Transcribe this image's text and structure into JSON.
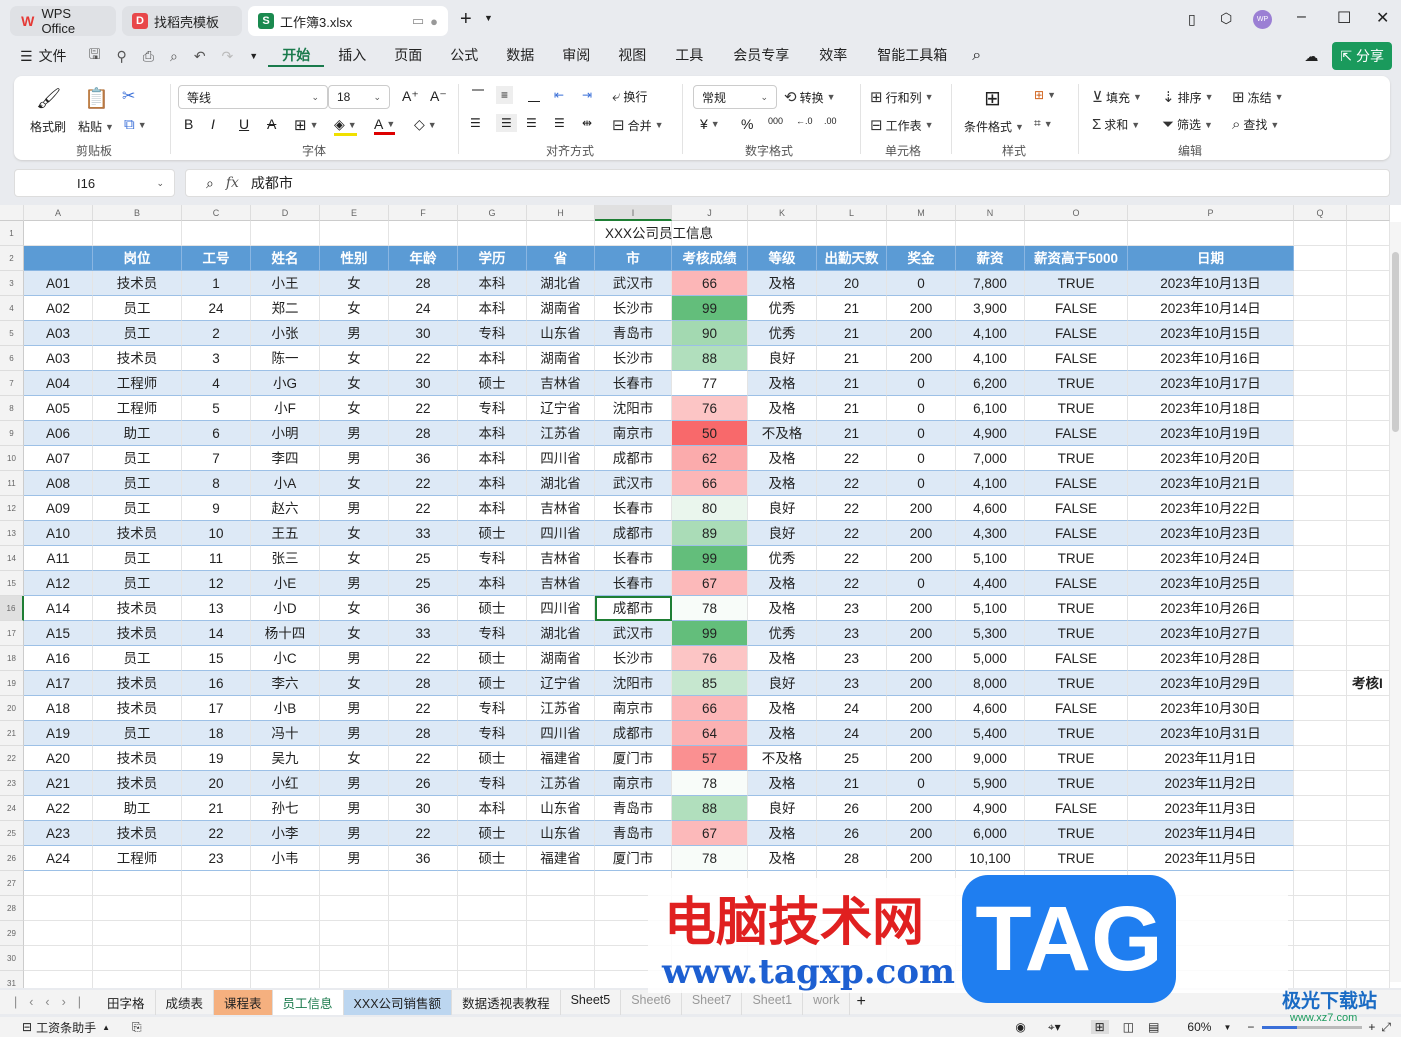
{
  "tabs": [
    {
      "label": "WPS Office",
      "icon": "W"
    },
    {
      "label": "找稻壳模板",
      "icon": "D"
    },
    {
      "label": "工作簿3.xlsx",
      "icon": "S"
    }
  ],
  "menu": {
    "file": "文件",
    "items": [
      "开始",
      "插入",
      "页面",
      "公式",
      "数据",
      "审阅",
      "视图",
      "工具",
      "会员专享",
      "效率",
      "智能工具箱"
    ],
    "share": "分享"
  },
  "ribbon": {
    "clipboard": {
      "format_painter": "格式刷",
      "paste": "粘贴",
      "label": "剪贴板"
    },
    "font": {
      "name": "等线",
      "size": "18",
      "label": "字体",
      "bold": "B",
      "italic": "I",
      "underline": "U"
    },
    "align": {
      "wrap": "换行",
      "merge": "合并",
      "label": "对齐方式"
    },
    "number": {
      "format": "常规",
      "convert": "转换",
      "label": "数字格式",
      "currency": "¥",
      "percent": "%"
    },
    "cells": {
      "rowcol": "行和列",
      "worksheet": "工作表",
      "label": "单元格"
    },
    "style": {
      "cond": "条件格式",
      "label": "样式"
    },
    "edit": {
      "fill": "填充",
      "sort": "排序",
      "freeze": "冻结",
      "sum": "求和",
      "filter": "筛选",
      "find": "查找",
      "label": "编辑"
    }
  },
  "formula_bar": {
    "cell": "I16",
    "fx": "fx",
    "value": "成都市"
  },
  "columns": [
    "A",
    "B",
    "C",
    "D",
    "E",
    "F",
    "G",
    "H",
    "I",
    "J",
    "K",
    "L",
    "M",
    "N",
    "O",
    "P",
    "Q"
  ],
  "title": "XXX公司员工信息",
  "headers": [
    "岗位",
    "工号",
    "姓名",
    "性别",
    "年龄",
    "学历",
    "省",
    "市",
    "考核成绩",
    "等级",
    "出勤天数",
    "奖金",
    "薪资",
    "薪资高于5000",
    "日期"
  ],
  "first_col": [
    "A01",
    "A02",
    "A03",
    "A03",
    "A04",
    "A05",
    "A06",
    "A07",
    "A08",
    "A09",
    "A10",
    "A11",
    "A12",
    "A14",
    "A15",
    "A16",
    "A17",
    "A18",
    "A19",
    "A20",
    "A21",
    "A22",
    "A23",
    "A24"
  ],
  "rows": [
    [
      "技术员",
      "1",
      "小王",
      "女",
      "28",
      "本科",
      "湖北省",
      "武汉市",
      66,
      "及格",
      "20",
      "0",
      "7,800",
      "TRUE",
      "2023年10月13日"
    ],
    [
      "员工",
      "24",
      "郑二",
      "女",
      "24",
      "本科",
      "湖南省",
      "长沙市",
      99,
      "优秀",
      "21",
      "200",
      "3,900",
      "FALSE",
      "2023年10月14日"
    ],
    [
      "员工",
      "2",
      "小张",
      "男",
      "30",
      "专科",
      "山东省",
      "青岛市",
      90,
      "优秀",
      "21",
      "200",
      "4,100",
      "FALSE",
      "2023年10月15日"
    ],
    [
      "技术员",
      "3",
      "陈一",
      "女",
      "22",
      "本科",
      "湖南省",
      "长沙市",
      88,
      "良好",
      "21",
      "200",
      "4,100",
      "FALSE",
      "2023年10月16日"
    ],
    [
      "工程师",
      "4",
      "小G",
      "女",
      "30",
      "硕士",
      "吉林省",
      "长春市",
      77,
      "及格",
      "21",
      "0",
      "6,200",
      "TRUE",
      "2023年10月17日"
    ],
    [
      "工程师",
      "5",
      "小F",
      "女",
      "22",
      "专科",
      "辽宁省",
      "沈阳市",
      76,
      "及格",
      "21",
      "0",
      "6,100",
      "TRUE",
      "2023年10月18日"
    ],
    [
      "助工",
      "6",
      "小明",
      "男",
      "28",
      "本科",
      "江苏省",
      "南京市",
      50,
      "不及格",
      "21",
      "0",
      "4,900",
      "FALSE",
      "2023年10月19日"
    ],
    [
      "员工",
      "7",
      "李四",
      "男",
      "36",
      "本科",
      "四川省",
      "成都市",
      62,
      "及格",
      "22",
      "0",
      "7,000",
      "TRUE",
      "2023年10月20日"
    ],
    [
      "员工",
      "8",
      "小A",
      "女",
      "22",
      "本科",
      "湖北省",
      "武汉市",
      66,
      "及格",
      "22",
      "0",
      "4,100",
      "FALSE",
      "2023年10月21日"
    ],
    [
      "员工",
      "9",
      "赵六",
      "男",
      "22",
      "本科",
      "吉林省",
      "长春市",
      80,
      "良好",
      "22",
      "200",
      "4,600",
      "FALSE",
      "2023年10月22日"
    ],
    [
      "技术员",
      "10",
      "王五",
      "女",
      "33",
      "硕士",
      "四川省",
      "成都市",
      89,
      "良好",
      "22",
      "200",
      "4,300",
      "FALSE",
      "2023年10月23日"
    ],
    [
      "员工",
      "11",
      "张三",
      "女",
      "25",
      "专科",
      "吉林省",
      "长春市",
      99,
      "优秀",
      "22",
      "200",
      "5,100",
      "TRUE",
      "2023年10月24日"
    ],
    [
      "员工",
      "12",
      "小E",
      "男",
      "25",
      "本科",
      "吉林省",
      "长春市",
      67,
      "及格",
      "22",
      "0",
      "4,400",
      "FALSE",
      "2023年10月25日"
    ],
    [
      "技术员",
      "13",
      "小D",
      "女",
      "36",
      "硕士",
      "四川省",
      "成都市",
      78,
      "及格",
      "23",
      "200",
      "5,100",
      "TRUE",
      "2023年10月26日"
    ],
    [
      "技术员",
      "14",
      "杨十四",
      "女",
      "33",
      "专科",
      "湖北省",
      "武汉市",
      99,
      "优秀",
      "23",
      "200",
      "5,300",
      "TRUE",
      "2023年10月27日"
    ],
    [
      "员工",
      "15",
      "小C",
      "男",
      "22",
      "硕士",
      "湖南省",
      "长沙市",
      76,
      "及格",
      "23",
      "200",
      "5,000",
      "FALSE",
      "2023年10月28日"
    ],
    [
      "技术员",
      "16",
      "李六",
      "女",
      "28",
      "硕士",
      "辽宁省",
      "沈阳市",
      85,
      "良好",
      "23",
      "200",
      "8,000",
      "TRUE",
      "2023年10月29日"
    ],
    [
      "技术员",
      "17",
      "小B",
      "男",
      "22",
      "专科",
      "江苏省",
      "南京市",
      66,
      "及格",
      "24",
      "200",
      "4,600",
      "FALSE",
      "2023年10月30日"
    ],
    [
      "员工",
      "18",
      "冯十",
      "男",
      "28",
      "专科",
      "四川省",
      "成都市",
      64,
      "及格",
      "24",
      "200",
      "5,400",
      "TRUE",
      "2023年10月31日"
    ],
    [
      "技术员",
      "19",
      "吴九",
      "女",
      "22",
      "硕士",
      "福建省",
      "厦门市",
      57,
      "不及格",
      "25",
      "200",
      "9,000",
      "TRUE",
      "2023年11月1日"
    ],
    [
      "技术员",
      "20",
      "小红",
      "男",
      "26",
      "专科",
      "江苏省",
      "南京市",
      78,
      "及格",
      "21",
      "0",
      "5,900",
      "TRUE",
      "2023年11月2日"
    ],
    [
      "助工",
      "21",
      "孙七",
      "男",
      "30",
      "本科",
      "山东省",
      "青岛市",
      88,
      "良好",
      "26",
      "200",
      "4,900",
      "FALSE",
      "2023年11月3日"
    ],
    [
      "技术员",
      "22",
      "小李",
      "男",
      "22",
      "硕士",
      "山东省",
      "青岛市",
      67,
      "及格",
      "26",
      "200",
      "6,000",
      "TRUE",
      "2023年11月4日"
    ],
    [
      "工程师",
      "23",
      "小韦",
      "男",
      "36",
      "硕士",
      "福建省",
      "厦门市",
      78,
      "及格",
      "28",
      "200",
      "10,100",
      "TRUE",
      "2023年11月5日"
    ]
  ],
  "side_text": "考核I",
  "sheet_tabs": [
    "田字格",
    "成绩表",
    "课程表",
    "员工信息",
    "XXX公司销售额",
    "数据透视表教程",
    "Sheet5",
    "Sheet6",
    "Sheet7",
    "Sheet1",
    "work"
  ],
  "status": {
    "assistant": "工资条助手",
    "zoom": "60%"
  },
  "watermark": {
    "cn": "电脑技术网",
    "tag": "TAG",
    "url": "www.tagxp.com",
    "site": "极光下载站",
    "site_url": "www.xz7.com"
  },
  "colors": {
    "header": "#5b9bd5",
    "accent": "#1a7a4c",
    "low": "#f8696b",
    "high": "#63be7b"
  }
}
